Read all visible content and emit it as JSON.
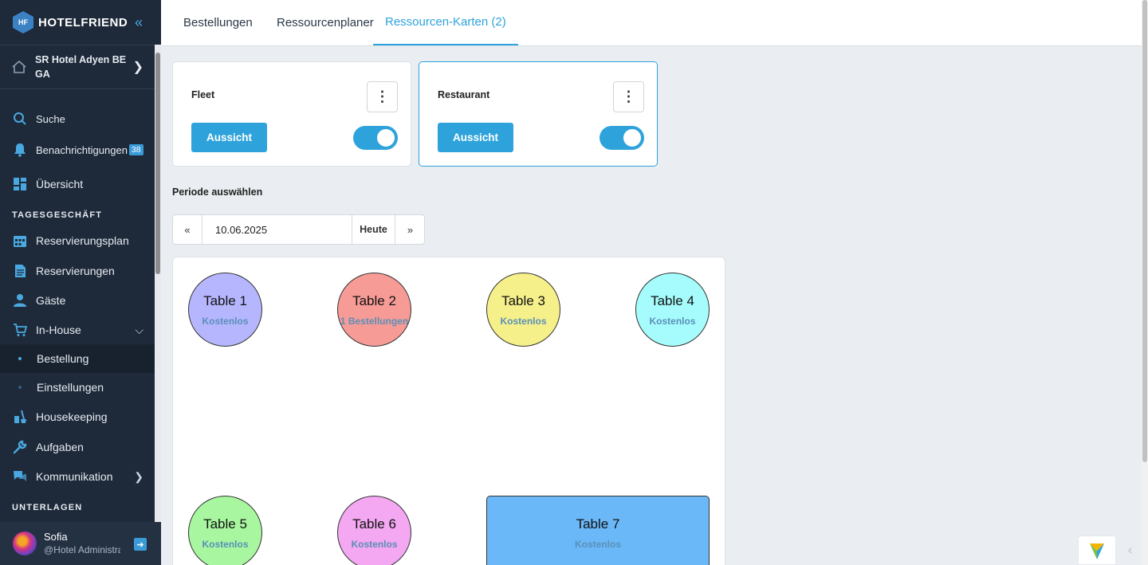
{
  "app": {
    "logo_text": "HOTELFRIEND",
    "logo_mark": "HF",
    "hotel_name": "SR Hotel Adyen BE GA"
  },
  "sidebar": {
    "search": "Suche",
    "notifications": "Benachrichtigungen",
    "notifications_count": "38",
    "overview": "Übersicht",
    "section_daily": "TAGESGESCHÄFT",
    "items": [
      {
        "label": "Reservierungsplan",
        "icon": "calendar-icon"
      },
      {
        "label": "Reservierungen",
        "icon": "document-icon"
      },
      {
        "label": "Gäste",
        "icon": "person-icon"
      },
      {
        "label": "In-House",
        "icon": "cart-icon"
      }
    ],
    "sub_items": [
      {
        "label": "Bestellung",
        "active": true
      },
      {
        "label": "Einstellungen",
        "active": false
      }
    ],
    "items2": [
      {
        "label": "Housekeeping",
        "icon": "cleaning-icon"
      },
      {
        "label": "Aufgaben",
        "icon": "wrench-icon"
      },
      {
        "label": "Kommunikation",
        "icon": "chat-icon"
      }
    ],
    "section_docs": "UNTERLAGEN",
    "user": {
      "name": "Sofia",
      "role": "@Hotel Administrator"
    }
  },
  "tabs": [
    {
      "label": "Bestellungen",
      "active": false
    },
    {
      "label": "Ressourcenplaner",
      "active": false
    },
    {
      "label": "Ressourcen-Karten (2)",
      "active": true
    }
  ],
  "resource_cards": [
    {
      "title": "Fleet",
      "button": "Aussicht",
      "enabled": true
    },
    {
      "title": "Restaurant",
      "button": "Aussicht",
      "enabled": true
    }
  ],
  "period": {
    "label": "Periode auswählen",
    "date": "10.06.2025",
    "today": "Heute",
    "prev": "«",
    "next": "»"
  },
  "tables": [
    {
      "name": "Table 1",
      "status": "Kostenlos",
      "color": "#b6b6ff"
    },
    {
      "name": "Table 2",
      "status": "1 Bestellungen",
      "color": "#f79b96"
    },
    {
      "name": "Table 3",
      "status": "Kostenlos",
      "color": "#f6f08a"
    },
    {
      "name": "Table 4",
      "status": "Kostenlos",
      "color": "#a6fcfc"
    },
    {
      "name": "Table 5",
      "status": "Kostenlos",
      "color": "#a8f7a0"
    },
    {
      "name": "Table 6",
      "status": "Kostenlos",
      "color": "#f3a8f1"
    },
    {
      "name": "Table 7",
      "status": "Kostenlos",
      "color": "#6ab8f7"
    }
  ],
  "colors": {
    "accent": "#2ea3db",
    "sidebar_bg": "#1e2a3a",
    "page_bg": "#eaedf1"
  }
}
